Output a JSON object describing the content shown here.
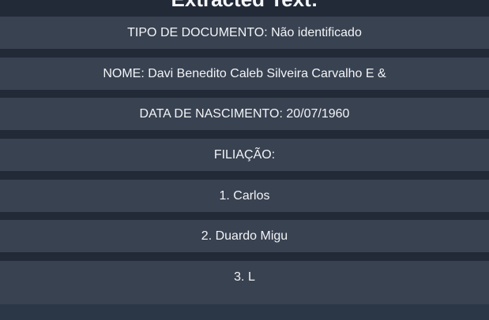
{
  "header": {
    "title": "Extracted Text:"
  },
  "lines": [
    "TIPO DE DOCUMENTO: Não identificado",
    "NOME: Davi Benedito Caleb Silveira Carvalho E &",
    "DATA DE NASCIMENTO: 20/07/1960",
    "FILIAÇÃO:",
    "1. Carlos",
    "2. Duardo Migu",
    "3. L"
  ],
  "colors": {
    "background": "#222937",
    "row": "#394251",
    "text": "#f2f4f7",
    "bottom_bar": "#2b3647"
  }
}
